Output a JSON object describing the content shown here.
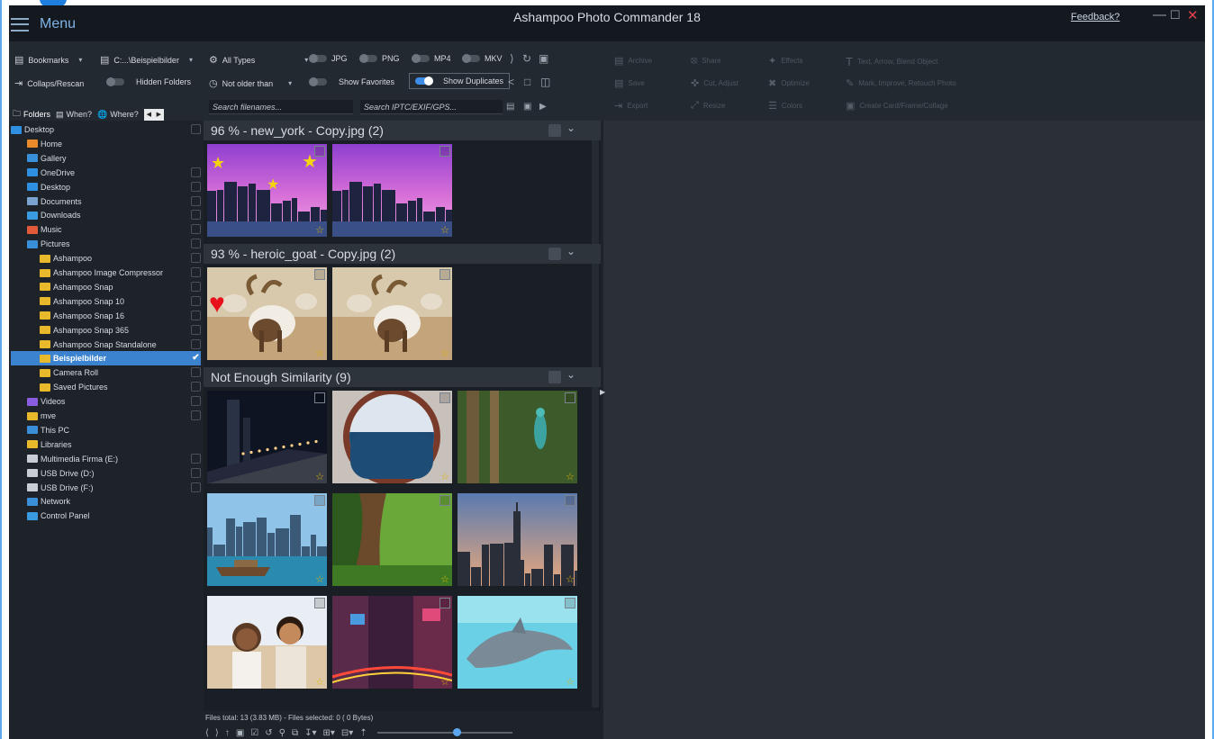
{
  "title_bar": {
    "menu_label": "Menu",
    "app_title": "Ashampoo Photo Commander 18",
    "feedback": "Feedback?"
  },
  "toolbar": {
    "bookmarks": "Bookmarks",
    "path": "C:...\\Beispielbilder",
    "collaps_rescan": "Collaps/Rescan",
    "hidden_folders": "Hidden Folders",
    "all_types": "All Types",
    "not_older_than": "Not older than",
    "show_favorites": "Show Favorites",
    "show_duplicates": "Show Duplicates",
    "search_filenames_placeholder": "Search filenames...",
    "search_meta_placeholder": "Search IPTC/EXIF/GPS...",
    "file_types": [
      {
        "label": "JPG",
        "on": false
      },
      {
        "label": "PNG",
        "on": false
      },
      {
        "label": "MP4",
        "on": false
      },
      {
        "label": "MKV",
        "on": false
      }
    ],
    "toggles": {
      "hidden_folders": false,
      "show_favorites": false,
      "show_duplicates": true
    },
    "disabled_actions": [
      {
        "icon": "archive-icon",
        "label": "Archive"
      },
      {
        "icon": "share-icon",
        "label": "Share"
      },
      {
        "icon": "effects-icon",
        "label": "Effects"
      },
      {
        "icon": "text-icon",
        "label": "Text, Arrow, Blend Object"
      },
      {
        "icon": "save-icon",
        "label": "Save"
      },
      {
        "icon": "crop-icon",
        "label": "Cut, Adjust"
      },
      {
        "icon": "optimize-icon",
        "label": "Optimize"
      },
      {
        "icon": "paint-icon",
        "label": "Mark, Improve, Retouch Photo"
      },
      {
        "icon": "export-icon",
        "label": "Export"
      },
      {
        "icon": "resize-icon",
        "label": "Resize"
      },
      {
        "icon": "colors-icon",
        "label": "Colors"
      },
      {
        "icon": "collage-icon",
        "label": "Create Card/Frame/Collage"
      }
    ]
  },
  "side_tabs": {
    "folders": "Folders",
    "when": "When?",
    "where": "Where?"
  },
  "tree": [
    {
      "label": "Desktop",
      "indent": 0,
      "icon": "desktop",
      "checkbox": true
    },
    {
      "label": "Home",
      "indent": 1,
      "icon": "home",
      "checkbox": false
    },
    {
      "label": "Gallery",
      "indent": 1,
      "icon": "gallery",
      "checkbox": false
    },
    {
      "label": "OneDrive",
      "indent": 1,
      "icon": "cloud",
      "checkbox": true
    },
    {
      "label": "Desktop",
      "indent": 1,
      "icon": "desktop",
      "checkbox": true
    },
    {
      "label": "Documents",
      "indent": 1,
      "icon": "documents",
      "checkbox": true
    },
    {
      "label": "Downloads",
      "indent": 1,
      "icon": "downloads",
      "checkbox": true
    },
    {
      "label": "Music",
      "indent": 1,
      "icon": "music",
      "checkbox": true
    },
    {
      "label": "Pictures",
      "indent": 1,
      "icon": "pictures",
      "checkbox": true
    },
    {
      "label": "Ashampoo",
      "indent": 2,
      "icon": "folder",
      "checkbox": true
    },
    {
      "label": "Ashampoo Image Compressor",
      "indent": 2,
      "icon": "folder",
      "checkbox": true
    },
    {
      "label": "Ashampoo Snap",
      "indent": 2,
      "icon": "folder",
      "checkbox": true
    },
    {
      "label": "Ashampoo Snap 10",
      "indent": 2,
      "icon": "folder",
      "checkbox": true
    },
    {
      "label": "Ashampoo Snap 16",
      "indent": 2,
      "icon": "folder",
      "checkbox": true
    },
    {
      "label": "Ashampoo Snap 365",
      "indent": 2,
      "icon": "folder",
      "checkbox": true
    },
    {
      "label": "Ashampoo Snap Standalone",
      "indent": 2,
      "icon": "folder",
      "checkbox": true
    },
    {
      "label": "Beispielbilder",
      "indent": 2,
      "icon": "folder",
      "checkbox": true,
      "selected": true
    },
    {
      "label": "Camera Roll",
      "indent": 2,
      "icon": "folder",
      "checkbox": true
    },
    {
      "label": "Saved Pictures",
      "indent": 2,
      "icon": "folder",
      "checkbox": true
    },
    {
      "label": "Videos",
      "indent": 1,
      "icon": "videos",
      "checkbox": true
    },
    {
      "label": "mve",
      "indent": 1,
      "icon": "folder",
      "checkbox": true
    },
    {
      "label": "This PC",
      "indent": 1,
      "icon": "pc",
      "checkbox": false
    },
    {
      "label": "Libraries",
      "indent": 1,
      "icon": "folder",
      "checkbox": false
    },
    {
      "label": "Multimedia Firma (E:)",
      "indent": 1,
      "icon": "drive",
      "checkbox": true
    },
    {
      "label": "USB Drive (D:)",
      "indent": 1,
      "icon": "drive",
      "checkbox": true
    },
    {
      "label": "USB Drive (F:)",
      "indent": 1,
      "icon": "drive",
      "checkbox": true
    },
    {
      "label": "Network",
      "indent": 1,
      "icon": "network",
      "checkbox": false
    },
    {
      "label": "Control Panel",
      "indent": 1,
      "icon": "control",
      "checkbox": false
    }
  ],
  "groups": [
    {
      "title": "96 % - new_york - Copy.jpg  (2)",
      "thumbs": [
        {
          "scene": "city-dusk",
          "badge": "stars"
        },
        {
          "scene": "city-dusk",
          "badge": ""
        }
      ]
    },
    {
      "title": "93 % - heroic_goat - Copy.jpg  (2)",
      "thumbs": [
        {
          "scene": "goat",
          "badge": "heart"
        },
        {
          "scene": "goat",
          "badge": ""
        }
      ]
    },
    {
      "title": "Not Enough Similarity  (9)",
      "thumbs": [
        {
          "scene": "night-pier",
          "badge": ""
        },
        {
          "scene": "porthole",
          "badge": ""
        },
        {
          "scene": "lizard",
          "badge": ""
        },
        {
          "scene": "skyline-boat",
          "badge": ""
        },
        {
          "scene": "forest",
          "badge": ""
        },
        {
          "scene": "ny-evening",
          "badge": ""
        },
        {
          "scene": "couple",
          "badge": ""
        },
        {
          "scene": "street-lights",
          "badge": ""
        },
        {
          "scene": "dolphin",
          "badge": ""
        }
      ]
    }
  ],
  "status": {
    "text": "Files total: 13 (3.83 MB) - Files selected: 0 (  0 Bytes)"
  },
  "zoom": {
    "fraction": 0.6
  },
  "colors": {
    "accent": "#3d8ce6",
    "selection": "#3b82cf",
    "app_bg": "#1e232a",
    "star": "#f5d40b",
    "heart": "#e8101a"
  }
}
